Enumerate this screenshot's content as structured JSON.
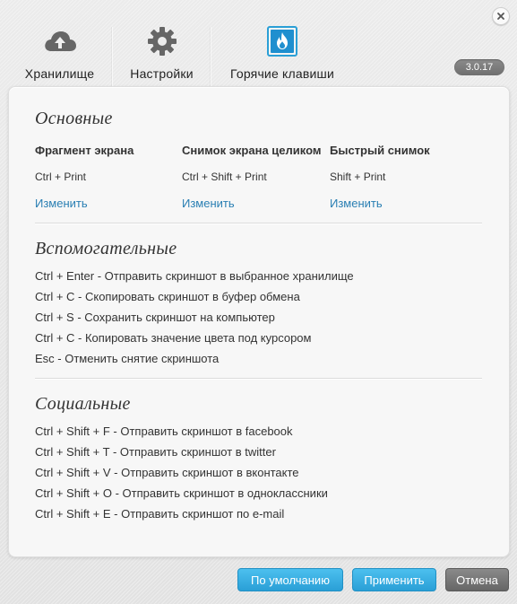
{
  "window": {
    "version": "3.0.17"
  },
  "tabs": [
    {
      "label": "Хранилище",
      "icon": "cloud-upload-icon"
    },
    {
      "label": "Настройки",
      "icon": "gear-icon"
    },
    {
      "label": "Горячие клавиши",
      "icon": "flame-icon"
    }
  ],
  "basic": {
    "title": "Основные",
    "columns": [
      {
        "header": "Фрагмент экрана",
        "shortcut": "Ctrl + Print",
        "change": "Изменить"
      },
      {
        "header": "Снимок экрана целиком",
        "shortcut": "Ctrl + Shift + Print",
        "change": "Изменить"
      },
      {
        "header": "Быстрый снимок",
        "shortcut": "Shift + Print",
        "change": "Изменить"
      }
    ]
  },
  "auxiliary": {
    "title": "Вспомогательные",
    "items": [
      "Ctrl + Enter - Отправить скриншот в выбранное хранилище",
      "Ctrl + C - Скопировать скриншот в буфер обмена",
      "Ctrl + S - Сохранить скриншот на компьютер",
      "Ctrl + C - Копировать значение цвета под курсором",
      "Esc - Отменить снятие скриншота"
    ]
  },
  "social": {
    "title": "Социальные",
    "items": [
      "Ctrl + Shift + F - Отправить скриншот в facebook",
      "Ctrl + Shift + T - Отправить скриншот в twitter",
      "Ctrl + Shift + V - Отправить скриншот в вконтакте",
      "Ctrl + Shift + O - Отправить скриншот в одноклассники",
      "Ctrl + Shift + E - Отправить скриншот по e-mail"
    ]
  },
  "buttons": {
    "default": "По умолчанию",
    "apply": "Применить",
    "cancel": "Отмена"
  },
  "colors": {
    "link": "#2a7fb3",
    "accent_blue": "#2a9fd6",
    "active_tab_icon": "#1f8fcf"
  }
}
